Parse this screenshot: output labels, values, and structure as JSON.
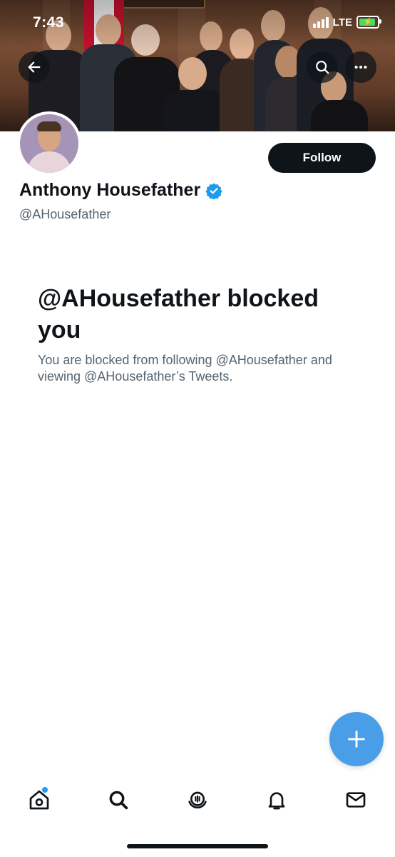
{
  "status_bar": {
    "time": "7:43",
    "network": "LTE"
  },
  "profile": {
    "display_name": "Anthony Housefather",
    "handle": "@AHousefather",
    "verified": true,
    "follow_label": "Follow"
  },
  "blocked": {
    "title": "@AHousefather blocked you",
    "description": "You are blocked from following @AHousefather and viewing @AHousefather’s Tweets."
  },
  "header_icons": [
    "back-arrow-icon",
    "search-icon",
    "more-icon"
  ],
  "tab_bar": {
    "items": [
      "home-icon",
      "search-icon",
      "spaces-icon",
      "notifications-icon",
      "messages-icon"
    ],
    "home_has_notification_dot": true
  },
  "colors": {
    "accent": "#1d9bf0",
    "fab": "#4a9ee8",
    "text_primary": "#0f1419",
    "text_secondary": "#536471"
  }
}
